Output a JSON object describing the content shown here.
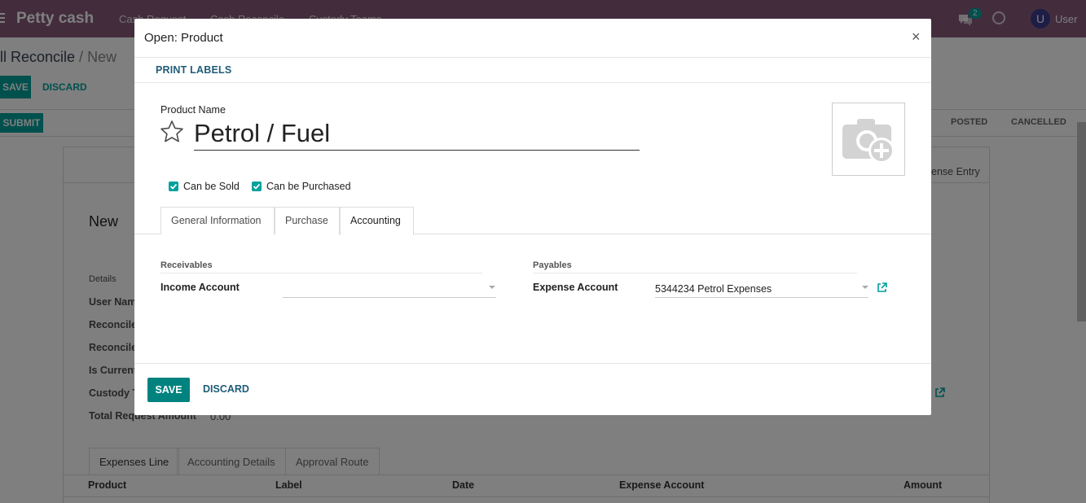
{
  "navbar": {
    "brand": "Petty cash",
    "menu": [
      "Cash Request",
      "Cash Reconcile",
      "Custody Teams"
    ],
    "chat_badge": "2",
    "avatar_letter": "U",
    "user_name": "User",
    "color": "#875a7b"
  },
  "page": {
    "breadcrumb_main": "ll Reconcile",
    "breadcrumb_sep": " / ",
    "breadcrumb_current": "New",
    "save_label": "SAVE",
    "discard_label": "DISCARD",
    "submit_label": "SUBMIT",
    "status_steps": [
      "POSTED",
      "CANCELLED"
    ],
    "smart_button": "ense Entry",
    "record_title": "New",
    "details_label": "Details",
    "field_labels": [
      "User Nam",
      "Reconcile",
      "Reconcile",
      "Is Current",
      "Custody T",
      "Total Request Amount"
    ],
    "total_amount": "0.00",
    "tabs": [
      "Expenses Line",
      "Accounting Details",
      "Approval Route"
    ],
    "table_headers": [
      "Product",
      "Label",
      "Date",
      "Expense Account",
      "Amount"
    ]
  },
  "modal": {
    "title": "Open: Product",
    "close_symbol": "×",
    "print_labels": "PRINT LABELS",
    "product_name_label": "Product Name",
    "product_name": "Petrol / Fuel",
    "can_be_sold": "Can be Sold",
    "can_be_purchased": "Can be Purchased",
    "tabs": [
      "General Information",
      "Purchase",
      "Accounting"
    ],
    "active_tab": "Accounting",
    "receivables": {
      "group_title": "Receivables",
      "field_label": "Income Account",
      "value": ""
    },
    "payables": {
      "group_title": "Payables",
      "field_label": "Expense Account",
      "value": "5344234 Petrol Expenses"
    },
    "save_label": "SAVE",
    "discard_label": "DISCARD",
    "accent": "#00a09d"
  }
}
